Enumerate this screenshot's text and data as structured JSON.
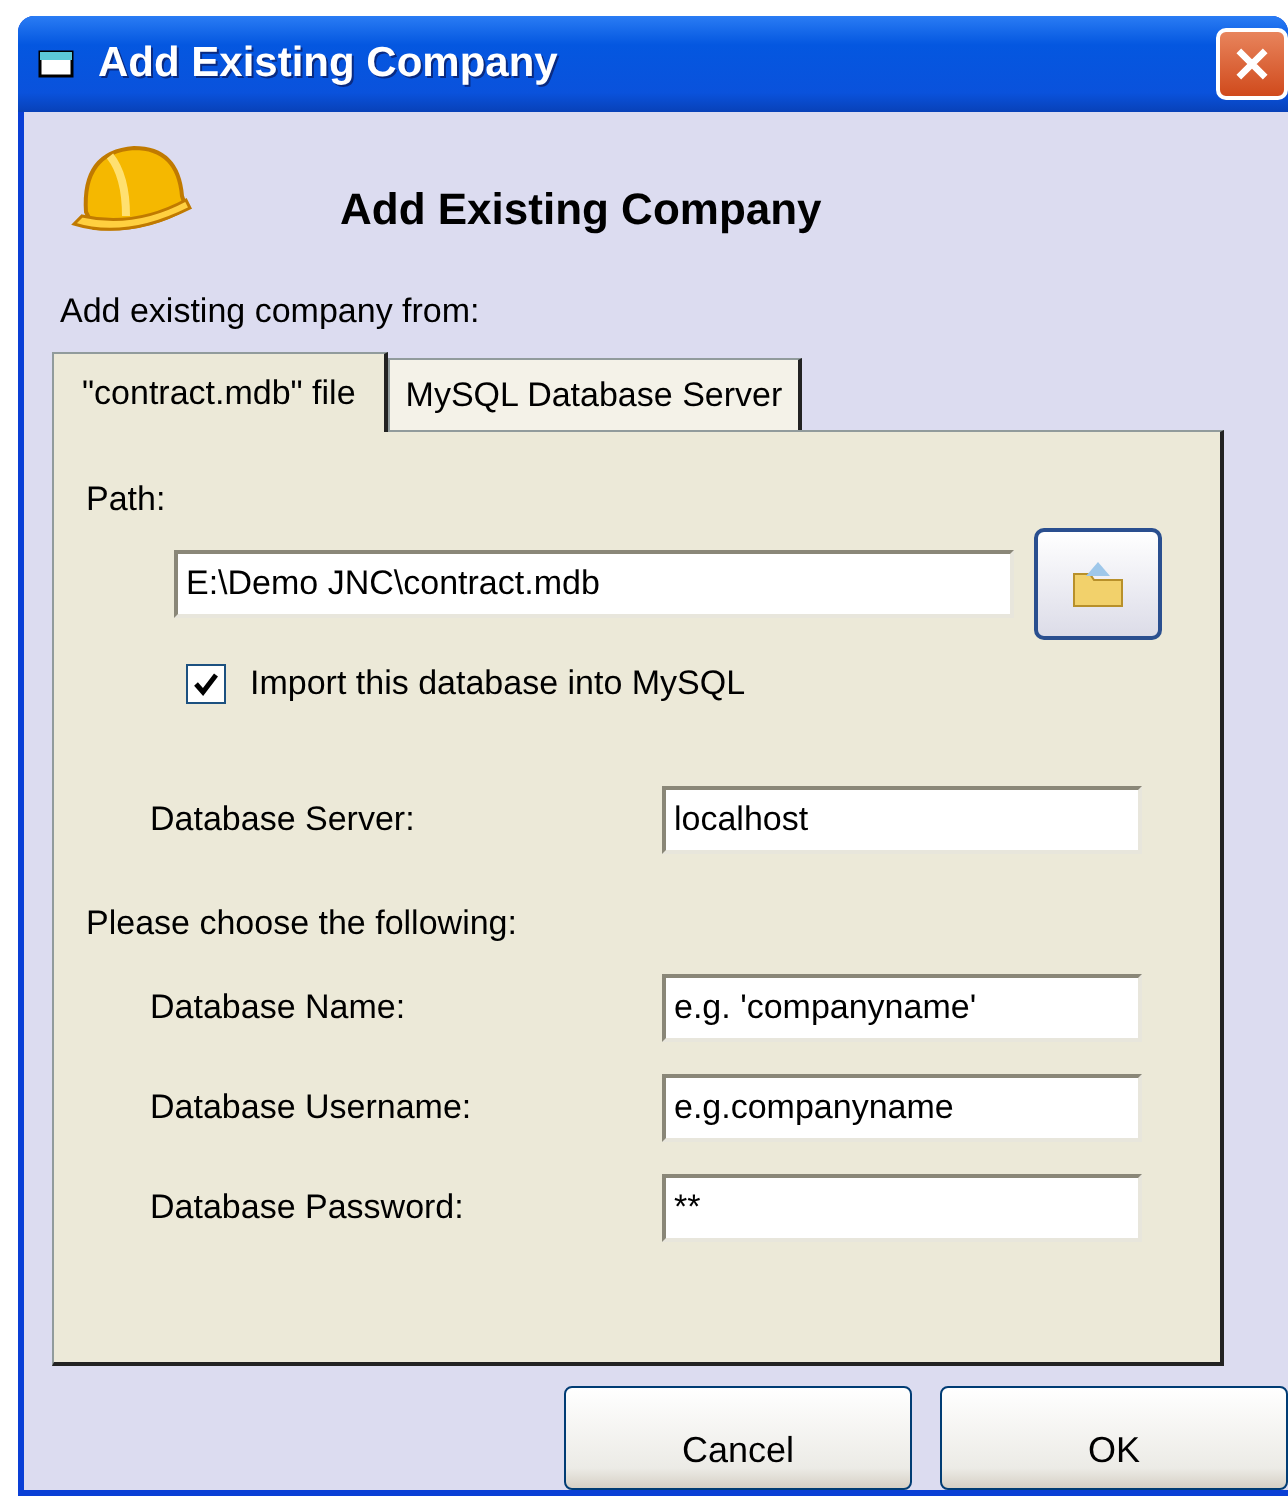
{
  "window": {
    "title": "Add Existing Company"
  },
  "header": {
    "title": "Add Existing Company"
  },
  "source_label": "Add existing company from:",
  "tabs": [
    {
      "label": "\"contract.mdb\" file",
      "selected": true
    },
    {
      "label": "MySQL Database Server",
      "selected": false
    }
  ],
  "path": {
    "label": "Path:",
    "value": "E:\\Demo JNC\\contract.mdb"
  },
  "import_checkbox": {
    "label": "Import this database into MySQL",
    "checked": true
  },
  "server": {
    "label": "Database Server:",
    "value": "localhost"
  },
  "choose_label": "Please choose the following:",
  "fields": [
    {
      "label": "Database Name:",
      "value": "e.g. 'companyname'"
    },
    {
      "label": "Database Username:",
      "value": "e.g.companyname"
    },
    {
      "label": "Database Password:",
      "value": "**"
    }
  ],
  "buttons": [
    "Cancel",
    "OK"
  ]
}
